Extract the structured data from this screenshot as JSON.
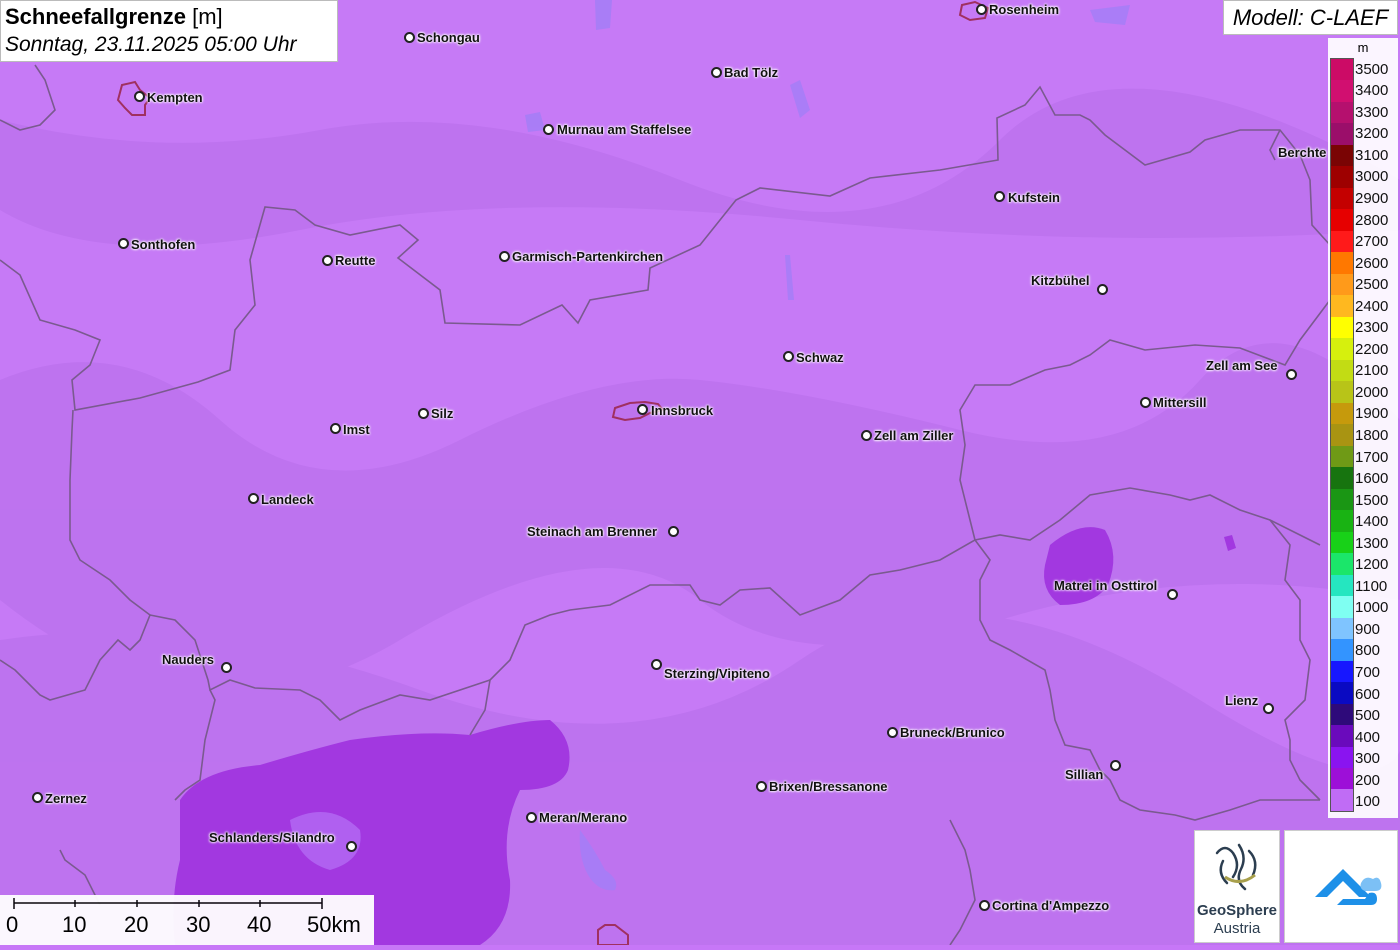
{
  "title": {
    "main": "Schneefallgrenze",
    "unit": "[m]",
    "subtitle": "Sonntag, 23.11.2025 05:00 Uhr"
  },
  "model": "Modell: C-LAEF",
  "legend": {
    "unit": "m",
    "levels": [
      {
        "label": "3500",
        "color": "#cc0b66"
      },
      {
        "label": "3400",
        "color": "#d10f70"
      },
      {
        "label": "3300",
        "color": "#b5106e"
      },
      {
        "label": "3200",
        "color": "#9b0e6a"
      },
      {
        "label": "3100",
        "color": "#7a0404"
      },
      {
        "label": "3000",
        "color": "#9e0000"
      },
      {
        "label": "2900",
        "color": "#c40000"
      },
      {
        "label": "2800",
        "color": "#e60000"
      },
      {
        "label": "2700",
        "color": "#ff1a1a"
      },
      {
        "label": "2600",
        "color": "#ff7800"
      },
      {
        "label": "2500",
        "color": "#ff9a1a"
      },
      {
        "label": "2400",
        "color": "#ffb81f"
      },
      {
        "label": "2300",
        "color": "#ffff00"
      },
      {
        "label": "2200",
        "color": "#d6f00d"
      },
      {
        "label": "2100",
        "color": "#c2dc14"
      },
      {
        "label": "2000",
        "color": "#b8c418"
      },
      {
        "label": "1900",
        "color": "#c69a0c"
      },
      {
        "label": "1800",
        "color": "#a99412"
      },
      {
        "label": "1700",
        "color": "#6f9a16"
      },
      {
        "label": "1600",
        "color": "#17740f"
      },
      {
        "label": "1500",
        "color": "#1a9614"
      },
      {
        "label": "1400",
        "color": "#19b313"
      },
      {
        "label": "1300",
        "color": "#18d118"
      },
      {
        "label": "1200",
        "color": "#1be66a"
      },
      {
        "label": "1100",
        "color": "#25e6c0"
      },
      {
        "label": "1000",
        "color": "#7ffff2"
      },
      {
        "label": "900",
        "color": "#7fc4ff"
      },
      {
        "label": "800",
        "color": "#3394ff"
      },
      {
        "label": "700",
        "color": "#1717ff"
      },
      {
        "label": "600",
        "color": "#0a0ac2"
      },
      {
        "label": "500",
        "color": "#2e0a7a"
      },
      {
        "label": "400",
        "color": "#6a0abc"
      },
      {
        "label": "300",
        "color": "#8a14f0"
      },
      {
        "label": "200",
        "color": "#9d0fd8"
      },
      {
        "label": "100",
        "color": "#c06cf5"
      }
    ]
  },
  "cities": [
    {
      "name": "Rosenheim"
    },
    {
      "name": "Schongau"
    },
    {
      "name": "Kempten"
    },
    {
      "name": "Bad Tölz"
    },
    {
      "name": "Murnau am Staffelsee"
    },
    {
      "name": "Berchte"
    },
    {
      "name": "Kufstein"
    },
    {
      "name": "Sonthofen"
    },
    {
      "name": "Reutte"
    },
    {
      "name": "Garmisch-Partenkirchen"
    },
    {
      "name": "Kitzbühel"
    },
    {
      "name": "Schwaz"
    },
    {
      "name": "Zell am See"
    },
    {
      "name": "Mittersill"
    },
    {
      "name": "Innsbruck"
    },
    {
      "name": "Silz"
    },
    {
      "name": "Imst"
    },
    {
      "name": "Zell am Ziller"
    },
    {
      "name": "Landeck"
    },
    {
      "name": "Steinach am Brenner"
    },
    {
      "name": "Matrei in Osttirol"
    },
    {
      "name": "Nauders"
    },
    {
      "name": "Sterzing/Vipiteno"
    },
    {
      "name": "Lienz"
    },
    {
      "name": "Bruneck/Brunico"
    },
    {
      "name": "Sillian"
    },
    {
      "name": "Brixen/Bressanone"
    },
    {
      "name": "Zernez"
    },
    {
      "name": "Meran/Merano"
    },
    {
      "name": "Schlanders/Silandro"
    },
    {
      "name": "Cortina d'Ampezzo"
    }
  ],
  "scale": {
    "labels": [
      "0",
      "10",
      "20",
      "30",
      "40",
      "50km"
    ]
  },
  "logos": {
    "geosphere_line1": "GeoSphere",
    "geosphere_line2": "Austria"
  }
}
